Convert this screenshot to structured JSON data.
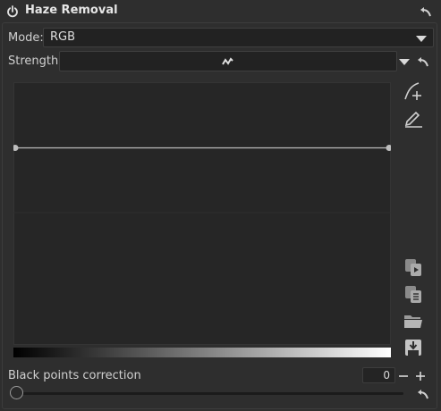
{
  "header": {
    "power_icon": "power-icon",
    "title": "Haze Removal",
    "reset_icon": "reset-arrow-icon"
  },
  "mode": {
    "label": "Mode:",
    "value": "RGB"
  },
  "strength": {
    "label": "Strength:",
    "curve_icon": "curve-shape-icon"
  },
  "curve": {
    "points": [
      [
        0,
        0.75
      ],
      [
        1,
        0.75
      ]
    ]
  },
  "side_tools": {
    "icons": [
      "curve-edit-point-icon",
      "pencil-icon",
      "copy-icon",
      "paste-icon",
      "open-folder-icon",
      "save-icon"
    ]
  },
  "black_points": {
    "label": "Black points correction",
    "value": "0",
    "level": 0,
    "minus": "−",
    "plus": "+"
  },
  "colors": {
    "background": "#2e2e2e",
    "curve_bg": "#262626",
    "curve_line": "#bdbdbd"
  }
}
